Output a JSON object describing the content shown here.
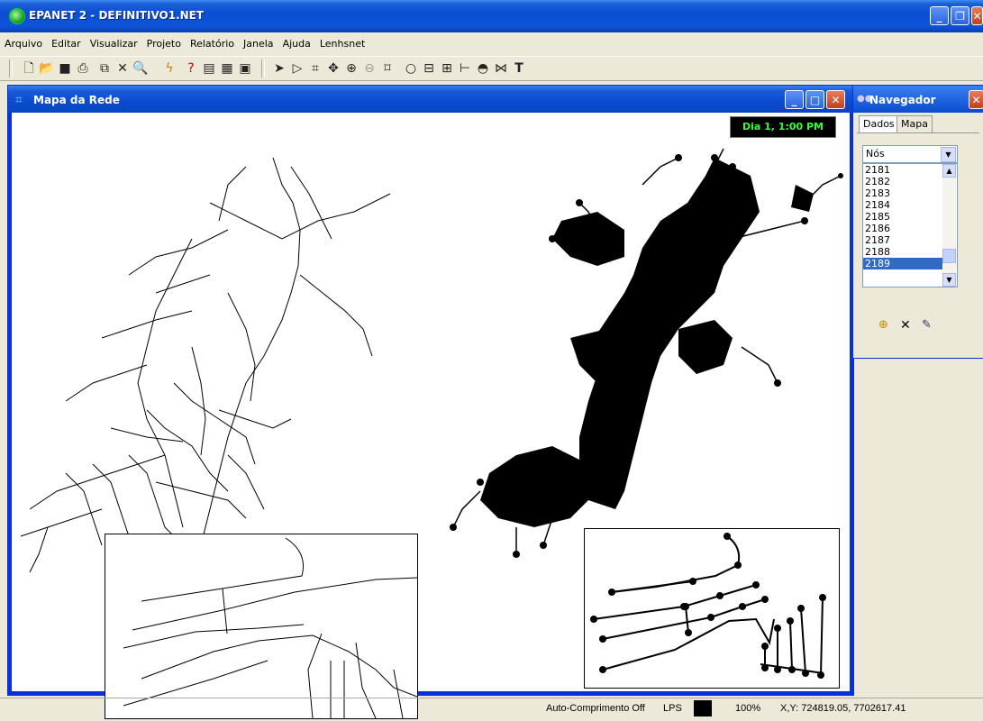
{
  "app": {
    "title": "EPANET 2 - DEFINITIVO1.NET"
  },
  "menu": [
    "Arquivo",
    "Editar",
    "Visualizar",
    "Projeto",
    "Relatório",
    "Janela",
    "Ajuda",
    "Lenhsnet"
  ],
  "map_window": {
    "title": "Mapa da Rede",
    "time": "Dia 1, 1:00 PM"
  },
  "navigator": {
    "title": "Navegador",
    "tabs": [
      "Dados",
      "Mapa"
    ],
    "object_type": "Nós",
    "items": [
      "2181",
      "2182",
      "2183",
      "2184",
      "2185",
      "2186",
      "2187",
      "2188",
      "2189"
    ],
    "selected": "2189"
  },
  "status": {
    "auto_length": "Auto-Comprimento Off",
    "units": "LPS",
    "zoom": "100%",
    "coords": "X,Y: 724819.05, 7702617.41"
  },
  "toolbar_icons": [
    "new-file-icon",
    "open-folder-icon",
    "save-icon",
    "print-icon",
    "copy-icon",
    "delete-icon",
    "find-icon",
    "run-icon",
    "query-icon",
    "graph-icon",
    "table-icon",
    "options-icon",
    "select-arrow-icon",
    "select-vertex-icon",
    "select-region-icon",
    "pan-icon",
    "zoom-in-icon",
    "zoom-out-icon",
    "full-extent-icon",
    "add-junction-icon",
    "add-reservoir-icon",
    "add-tank-icon",
    "add-pipe-icon",
    "add-pump-icon",
    "add-valve-icon",
    "add-label-icon"
  ]
}
